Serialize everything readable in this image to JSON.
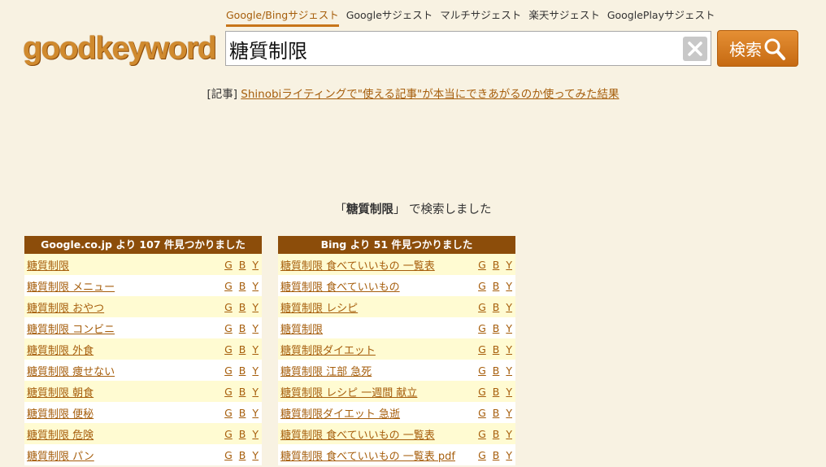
{
  "nav": [
    "Google/Bingサジェスト",
    "Googleサジェスト",
    "マルチサジェスト",
    "楽天サジェスト",
    "GooglePlayサジェスト"
  ],
  "logo": "goodkeyword",
  "search": {
    "value": "糖質制限"
  },
  "search_button": "検索",
  "article": {
    "tag": "[記事]",
    "link": "Shinobiライティングで\"使える記事\"が本当にできあがるのか使ってみた結果"
  },
  "result": {
    "open": "「",
    "keyword": "糖質制限",
    "close": "」",
    "suffix": "で検索しました"
  },
  "google": {
    "header": "Google.co.jp より 107 件見つかりました",
    "items": [
      "糖質制限",
      "糖質制限 メニュー",
      "糖質制限 おやつ",
      "糖質制限 コンビニ",
      "糖質制限 外食",
      "糖質制限 痩せない",
      "糖質制限 朝食",
      "糖質制限 便秘",
      "糖質制限 危険",
      "糖質制限 パン"
    ]
  },
  "bing": {
    "header": "Bing より 51 件見つかりました",
    "items": [
      "糖質制限 食べていいもの 一覧表",
      "糖質制限 食べていいもの",
      "糖質制限 レシピ",
      "糖質制限",
      "糖質制限ダイエット",
      "糖質制限 江部 急死",
      "糖質制限 レシピ 一週間 献立",
      "糖質制限ダイエット 急逝",
      "糖質制限 食べていいもの 一覧表",
      "糖質制限 食べていいもの 一覧表 pdf"
    ]
  },
  "row_links": [
    "G",
    "B",
    "Y"
  ],
  "colors": {
    "accent": "#a65e0c",
    "header_bg": "#8c4d0a",
    "button": "#d67a1f",
    "background": "#f8f2e2"
  }
}
